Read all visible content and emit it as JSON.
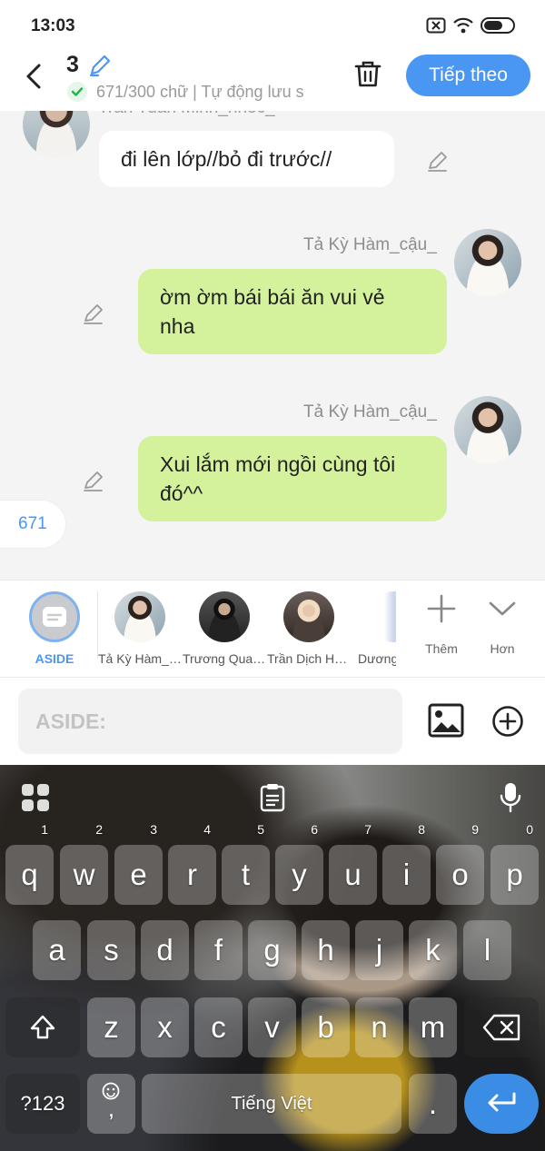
{
  "status_bar": {
    "time": "13:03",
    "icons": [
      "sim-off-icon",
      "wifi-icon",
      "battery-icon"
    ]
  },
  "header": {
    "title": "3",
    "subtitle": "671/300 chữ | Tự động lưu s",
    "next_button": "Tiếp theo",
    "icons": [
      "back-icon",
      "edit-icon",
      "check-icon",
      "trash-icon"
    ]
  },
  "messages": [
    {
      "sender": "Trần Tuấn Minh_nhóc_",
      "text": "đi lên lớp//bỏ đi trước//",
      "side": "left"
    },
    {
      "sender": "Tả Kỳ Hàm_cậu_",
      "text": "ờm ờm bái bái ăn vui vẻ nha",
      "side": "right"
    },
    {
      "sender": "Tả Kỳ Hàm_cậu_",
      "text": "Xui lắm mới ngồi cùng tôi đó^^",
      "side": "right"
    }
  ],
  "count_badge": "671",
  "characters": {
    "aside": "ASIDE",
    "items": [
      "Tả Kỳ Hàm_cậu_",
      "Trương Quang",
      "Trần Dịch Hằng",
      "Dương"
    ],
    "more_label": "Thêm",
    "expand_label": "Hơn"
  },
  "input": {
    "placeholder": "ASIDE:",
    "value": ""
  },
  "keyboard": {
    "row1": [
      "q",
      "w",
      "e",
      "r",
      "t",
      "y",
      "u",
      "i",
      "o",
      "p"
    ],
    "row1_nums": [
      "1",
      "2",
      "3",
      "4",
      "5",
      "6",
      "7",
      "8",
      "9",
      "0"
    ],
    "row2": [
      "a",
      "s",
      "d",
      "f",
      "g",
      "h",
      "j",
      "k",
      "l"
    ],
    "row3": [
      "z",
      "x",
      "c",
      "v",
      "b",
      "n",
      "m"
    ],
    "symbols_key": "?123",
    "comma_key": ",",
    "space_label": "Tiếng Việt",
    "period_key": "."
  },
  "colors": {
    "accent": "#4a97f3",
    "bubble_green": "#d3f29b",
    "bubble_white": "#ffffff"
  }
}
